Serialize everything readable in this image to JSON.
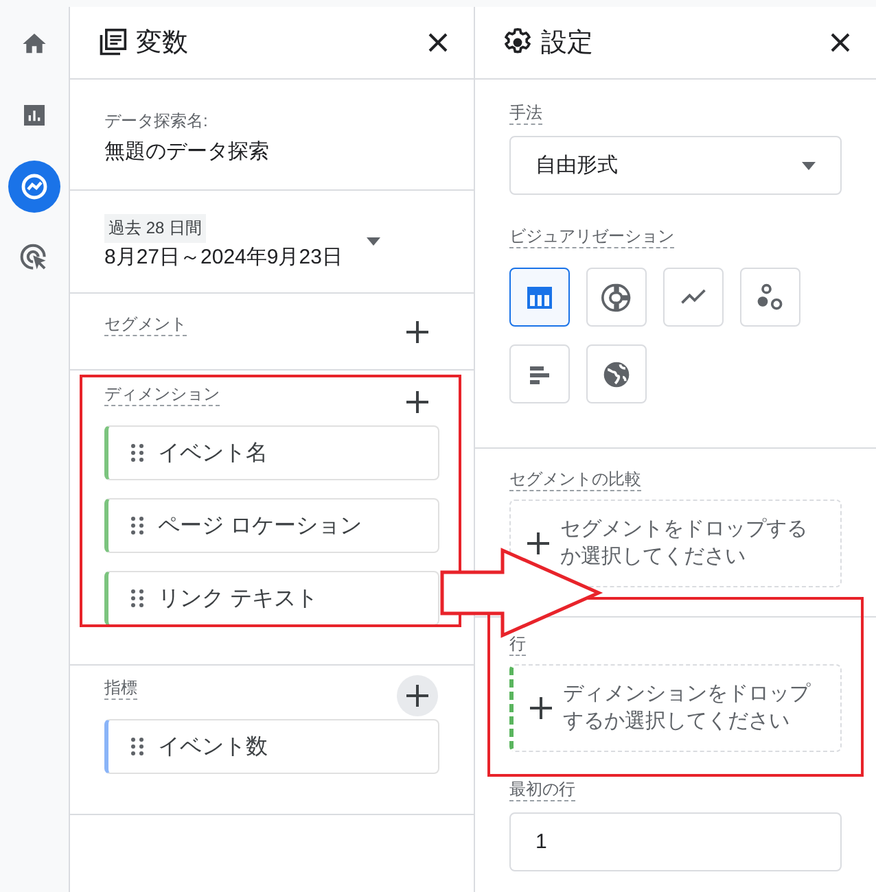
{
  "nav": [
    {
      "kind": "home",
      "selected": false
    },
    {
      "kind": "reports",
      "selected": false
    },
    {
      "kind": "explore",
      "selected": true
    },
    {
      "kind": "advertising",
      "selected": false
    }
  ],
  "variables": {
    "title": "変数",
    "exploration_name": {
      "label": "データ探索名:",
      "value": "無題のデータ探索"
    },
    "date_range": {
      "badge": "過去 28 日間",
      "range": "8月27日～2024年9月23日"
    },
    "segments": {
      "label": "セグメント"
    },
    "dimensions": {
      "label": "ディメンション",
      "highlighted": true,
      "items": [
        {
          "name": "イベント名"
        },
        {
          "name": "ページ ロケーション"
        },
        {
          "name": "リンク テキスト"
        }
      ]
    },
    "metrics": {
      "label": "指標",
      "items": [
        {
          "name": "イベント数"
        }
      ]
    }
  },
  "settings": {
    "title": "設定",
    "technique": {
      "label": "手法",
      "value": "自由形式"
    },
    "visualization": {
      "label": "ビジュアリゼーション",
      "options": [
        {
          "kind": "table",
          "selected": true
        },
        {
          "kind": "donut",
          "selected": false
        },
        {
          "kind": "line",
          "selected": false
        },
        {
          "kind": "scatter",
          "selected": false
        },
        {
          "kind": "bar",
          "selected": false
        },
        {
          "kind": "geo",
          "selected": false
        }
      ]
    },
    "segment_comparison": {
      "label": "セグメントの比較",
      "placeholder": "セグメントをドロップするか選択してください"
    },
    "rows": {
      "label": "行",
      "placeholder": "ディメンションをドロップするか選択してください",
      "highlighted": true
    },
    "start_row": {
      "label": "最初の行",
      "value": "1"
    }
  },
  "annotation_arrow": true
}
